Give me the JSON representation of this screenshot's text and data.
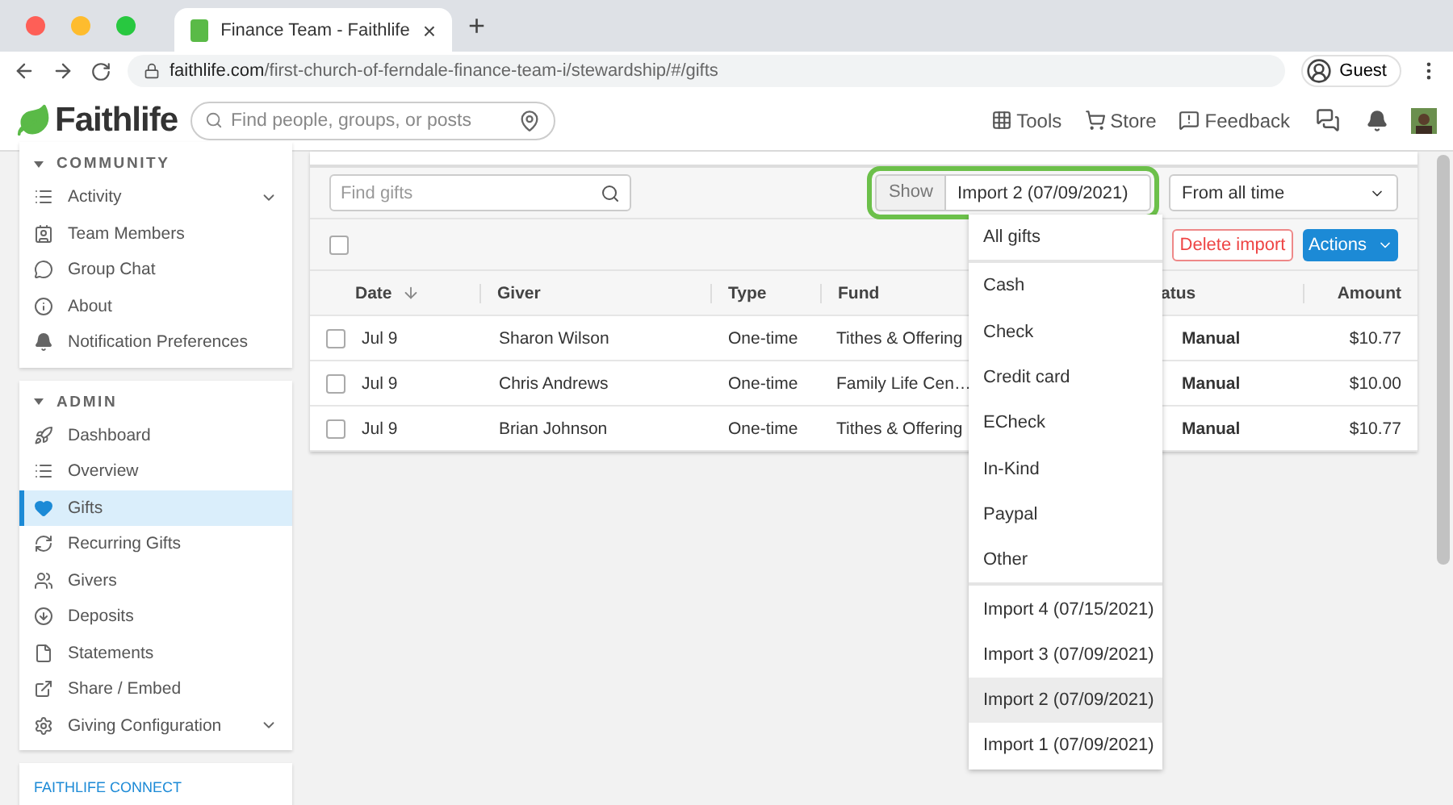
{
  "browser": {
    "tab_title": "Finance Team - Faithlife",
    "tab_close": "×",
    "new_tab": "+",
    "url_domain": "faithlife.com",
    "url_path": "/first-church-of-ferndale-finance-team-i/stewardship/#/gifts",
    "profile": "Guest"
  },
  "header": {
    "logo": "Faithlife",
    "search_placeholder": "Find people, groups, or posts",
    "links": [
      {
        "label": "Tools"
      },
      {
        "label": "Store"
      },
      {
        "label": "Feedback"
      }
    ]
  },
  "sidebar": {
    "sections": [
      {
        "title": "COMMUNITY",
        "items": [
          {
            "label": "Activity",
            "selected": false,
            "expandable": true
          },
          {
            "label": "Team Members",
            "selected": false,
            "expandable": false
          },
          {
            "label": "Group Chat",
            "selected": false,
            "expandable": false
          },
          {
            "label": "About",
            "selected": false,
            "expandable": false
          },
          {
            "label": "Notification Preferences",
            "selected": false,
            "expandable": false
          }
        ]
      },
      {
        "title": "ADMIN",
        "items": [
          {
            "label": "Dashboard",
            "selected": false,
            "expandable": false
          },
          {
            "label": "Overview",
            "selected": false,
            "expandable": false
          },
          {
            "label": "Gifts",
            "selected": true,
            "expandable": false
          },
          {
            "label": "Recurring Gifts",
            "selected": false,
            "expandable": false
          },
          {
            "label": "Givers",
            "selected": false,
            "expandable": false
          },
          {
            "label": "Deposits",
            "selected": false,
            "expandable": false
          },
          {
            "label": "Statements",
            "selected": false,
            "expandable": false
          },
          {
            "label": "Share / Embed",
            "selected": false,
            "expandable": false
          },
          {
            "label": "Giving Configuration",
            "selected": false,
            "expandable": true
          }
        ]
      }
    ],
    "footer_link": "FAITHLIFE CONNECT"
  },
  "toolbar": {
    "search_placeholder": "Find gifts",
    "show_label": "Show",
    "show_value": "Import 2 (07/09/2021)",
    "range_value": "From all time",
    "select_all_checked": false,
    "delete_button": "Delete import",
    "actions_button": "Actions"
  },
  "table": {
    "columns": [
      "Date",
      "Giver",
      "Type",
      "Fund",
      "atus",
      "Amount"
    ],
    "rows": [
      {
        "date": "Jul 9",
        "giver": "Sharon Wilson",
        "type": "One-time",
        "fund": "Tithes & Offering",
        "status": "Manual",
        "amount": "$10.77",
        "checked": false
      },
      {
        "date": "Jul 9",
        "giver": "Chris Andrews",
        "type": "One-time",
        "fund": "Family Life Cen…",
        "status": "Manual",
        "amount": "$10.00",
        "checked": false
      },
      {
        "date": "Jul 9",
        "giver": "Brian Johnson",
        "type": "One-time",
        "fund": "Tithes & Offering",
        "status": "Manual",
        "amount": "$10.77",
        "checked": false
      }
    ]
  },
  "dropdown": {
    "groups": [
      [
        {
          "label": "All gifts",
          "selected": false
        }
      ],
      [
        {
          "label": "Cash",
          "selected": false
        },
        {
          "label": "Check",
          "selected": false
        },
        {
          "label": "Credit card",
          "selected": false
        },
        {
          "label": "ECheck",
          "selected": false
        },
        {
          "label": "In-Kind",
          "selected": false
        },
        {
          "label": "Paypal",
          "selected": false
        },
        {
          "label": "Other",
          "selected": false
        }
      ],
      [
        {
          "label": "Import 4 (07/15/2021)",
          "selected": false
        },
        {
          "label": "Import 3 (07/09/2021)",
          "selected": false
        },
        {
          "label": "Import 2 (07/09/2021)",
          "selected": true
        },
        {
          "label": "Import 1 (07/09/2021)",
          "selected": false
        }
      ]
    ]
  }
}
